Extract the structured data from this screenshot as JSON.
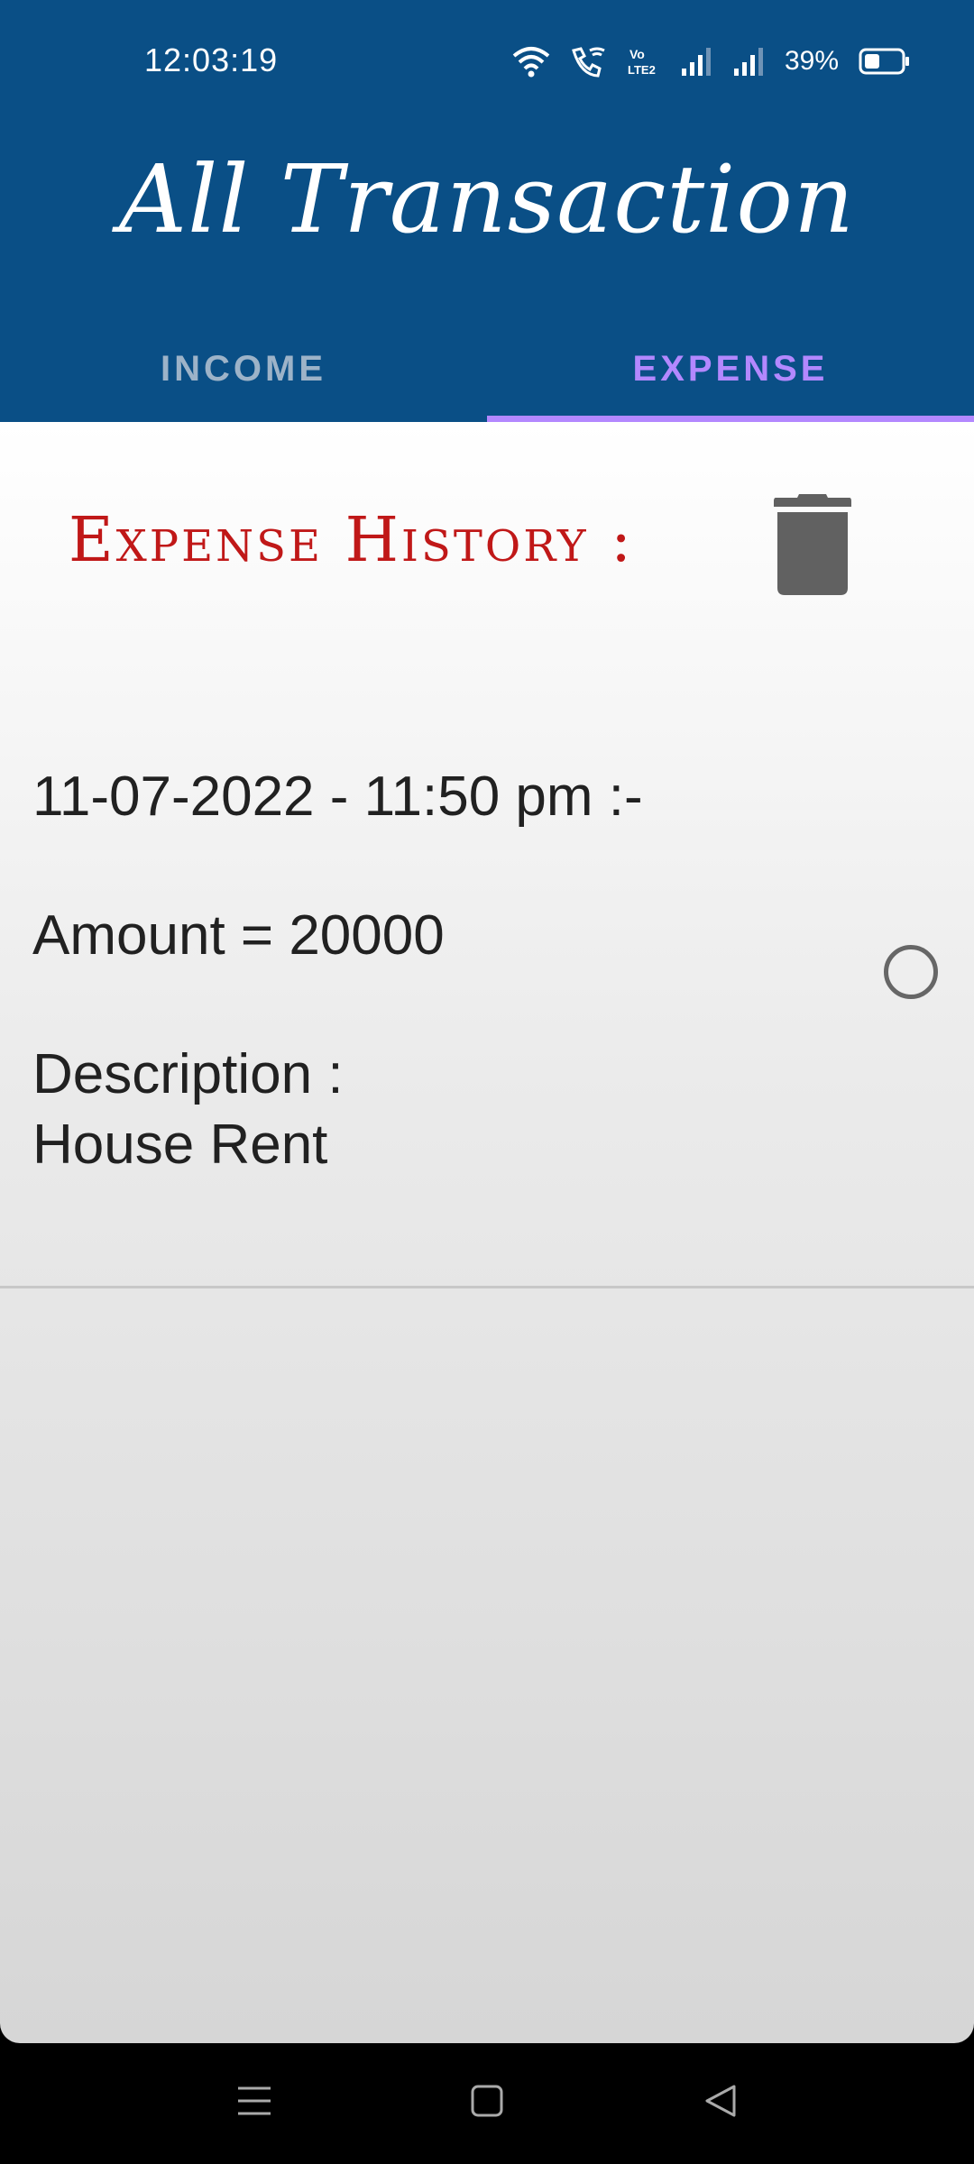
{
  "status_bar": {
    "time": "12:03:19",
    "battery_percent": "39%",
    "icons": [
      "wifi-icon",
      "wifi-calling-icon",
      "volte-icon",
      "signal-icon",
      "signal-icon",
      "battery-icon"
    ]
  },
  "app": {
    "title": "All Transaction"
  },
  "tabs": [
    {
      "label": "INCOME",
      "selected": false
    },
    {
      "label": "EXPENSE",
      "selected": true
    }
  ],
  "history": {
    "title": "Expense History :",
    "delete_icon": "trash-icon"
  },
  "transactions": [
    {
      "datetime": "11-07-2022 - 11:50 pm :-",
      "amount": "Amount = 20000",
      "description_label": "Description :",
      "description_value": "House Rent",
      "selected": false
    }
  ],
  "nav_bar": {
    "icons": [
      "menu-icon",
      "home-icon",
      "back-icon"
    ]
  },
  "colors": {
    "header": "#0a4f86",
    "tab_selected": "#b388ff",
    "tab_unselected": "#9db3c8",
    "history_title": "#c01818",
    "text": "#212121"
  }
}
